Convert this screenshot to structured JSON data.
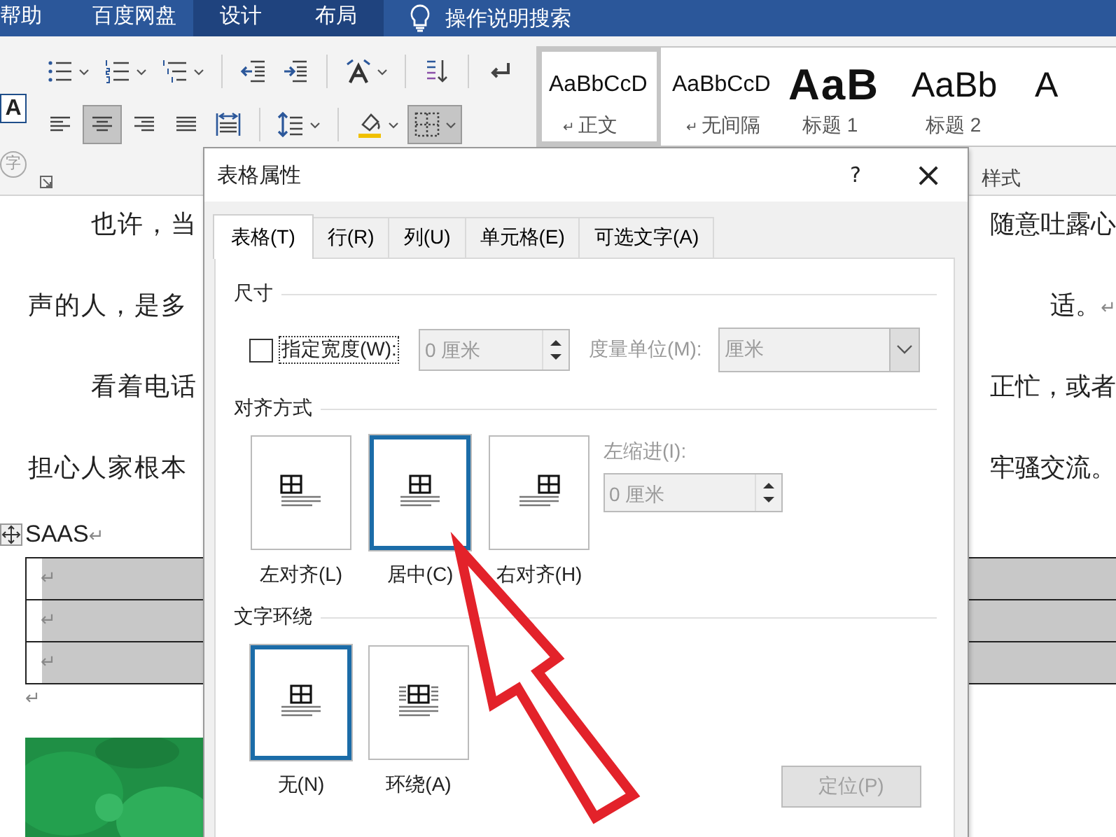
{
  "menu_tabs": [
    {
      "label": "帮助",
      "kind": "normal"
    },
    {
      "label": "百度网盘",
      "kind": "normal"
    },
    {
      "label": "设计",
      "kind": "contextual"
    },
    {
      "label": "布局",
      "kind": "contextual"
    }
  ],
  "search": {
    "label": "操作说明搜索"
  },
  "ribbon": {
    "char_border_icon": "A",
    "enclosed_char_icon": "字",
    "paragraph_row1": [
      [
        {
          "kind": "bullets",
          "dropdown": true,
          "selected": false
        },
        {
          "kind": "numbering",
          "dropdown": true,
          "selected": false
        },
        {
          "kind": "multilevel",
          "dropdown": true,
          "selected": false
        }
      ],
      [
        {
          "kind": "outdent",
          "dropdown": false,
          "selected": false
        },
        {
          "kind": "indent",
          "dropdown": false,
          "selected": false
        }
      ],
      [
        {
          "kind": "asian-layout",
          "dropdown": true,
          "selected": false
        }
      ],
      [
        {
          "kind": "sort",
          "dropdown": false,
          "selected": false
        }
      ],
      [
        {
          "kind": "paragraph-marks",
          "dropdown": false,
          "selected": false
        }
      ]
    ],
    "paragraph_row2": [
      [
        {
          "kind": "align-left",
          "dropdown": false,
          "selected": false
        },
        {
          "kind": "align-center",
          "dropdown": false,
          "selected": true
        },
        {
          "kind": "align-right",
          "dropdown": false,
          "selected": false
        },
        {
          "kind": "justify",
          "dropdown": false,
          "selected": false
        },
        {
          "kind": "distributed",
          "dropdown": false,
          "selected": false
        }
      ],
      [
        {
          "kind": "line-spacing",
          "dropdown": true,
          "selected": false
        }
      ],
      [
        {
          "kind": "shading",
          "dropdown": true,
          "selected": false
        },
        {
          "kind": "borders",
          "dropdown": true,
          "selected": true
        }
      ]
    ],
    "styles": [
      {
        "sample": "AaBbCcD",
        "mark": "↵",
        "name": "正文",
        "kind": "normal",
        "selected": true
      },
      {
        "sample": "AaBbCcD",
        "mark": "↵",
        "name": "无间隔",
        "kind": "normal",
        "selected": false
      },
      {
        "sample": "AaB",
        "name": "标题 1",
        "kind": "heading1",
        "selected": false
      },
      {
        "sample": "AaBb",
        "name": "标题 2",
        "kind": "heading2",
        "selected": false
      },
      {
        "sample": "A",
        "kind": "heading2",
        "selected": false
      }
    ],
    "styles_label": "样式"
  },
  "document": {
    "lines": [
      {
        "kind": "first",
        "left": "也许，当",
        "right": "随意吐露心"
      },
      {
        "kind": "wrap",
        "left": "声的人，是多",
        "right": "适。",
        "mark": "↵"
      },
      {
        "kind": "first",
        "left": "看着电话",
        "right": "正忙，或者"
      },
      {
        "kind": "wrap",
        "left": "担心人家根本",
        "right": "牢骚交流。"
      }
    ],
    "table_caption": "SAAS",
    "caption_mark": "↵",
    "table_rows": [
      {
        "mark": "↵"
      },
      {
        "mark": "↵"
      },
      {
        "mark": "↵"
      }
    ],
    "after_mark": "↵"
  },
  "dialog": {
    "title": "表格属性",
    "help": "?",
    "close": "×",
    "tabs": [
      {
        "label": "表格(T)",
        "selected": true
      },
      {
        "label": "行(R)",
        "selected": false
      },
      {
        "label": "列(U)",
        "selected": false
      },
      {
        "label": "单元格(E)",
        "selected": false
      },
      {
        "label": "可选文字(A)",
        "selected": false
      }
    ],
    "size": {
      "heading": "尺寸",
      "checked": false,
      "checkbox_label": "指定宽度(W):",
      "width_value": "0 厘米",
      "width_disabled": true,
      "unit_label": "度量单位(M):",
      "unit_value": "厘米",
      "unit_disabled": true
    },
    "alignment": {
      "heading": "对齐方式",
      "options": [
        {
          "kind": "left",
          "label": "左对齐(L)",
          "selected": false
        },
        {
          "kind": "center",
          "label": "居中(C)",
          "selected": true
        },
        {
          "kind": "right",
          "label": "右对齐(H)",
          "selected": false
        }
      ],
      "indent_label": "左缩进(I):",
      "indent_value": "0 厘米",
      "indent_disabled": true
    },
    "wrapping": {
      "heading": "文字环绕",
      "options": [
        {
          "kind": "none",
          "label": "无(N)",
          "selected": true
        },
        {
          "kind": "around",
          "label": "环绕(A)",
          "selected": false
        }
      ],
      "position_button": "定位(P)",
      "position_disabled": true
    }
  }
}
